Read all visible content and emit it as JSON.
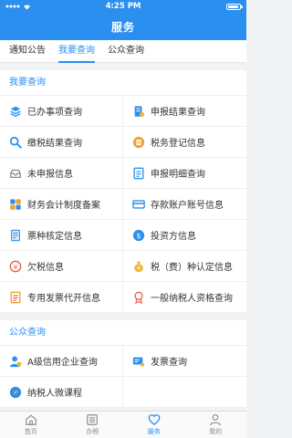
{
  "status": {
    "time": "4:25 PM"
  },
  "header": {
    "title": "服务"
  },
  "tabs": [
    {
      "label": "通知公告"
    },
    {
      "label": "我要查询"
    },
    {
      "label": "公众查询"
    }
  ],
  "section1": {
    "title": "我要查询",
    "items": [
      {
        "label": "已办事项查询",
        "icon": "layers-icon"
      },
      {
        "label": "申报结果查询",
        "icon": "document-icon"
      },
      {
        "label": "缴税结果查询",
        "icon": "search-icon"
      },
      {
        "label": "税务登记信息",
        "icon": "clipboard-icon"
      },
      {
        "label": "未申报信息",
        "icon": "inbox-icon"
      },
      {
        "label": "申报明细查询",
        "icon": "form-icon"
      },
      {
        "label": "财务会计制度备案",
        "icon": "grid-icon"
      },
      {
        "label": "存款账户账号信息",
        "icon": "card-icon"
      },
      {
        "label": "票种核定信息",
        "icon": "ticket-icon"
      },
      {
        "label": "投资方信息",
        "icon": "investor-icon"
      },
      {
        "label": "欠税信息",
        "icon": "debt-icon"
      },
      {
        "label": "税（费）种认定信息",
        "icon": "tax-bag-icon"
      },
      {
        "label": "专用发票代开信息",
        "icon": "invoice-icon"
      },
      {
        "label": "一般纳税人资格查询",
        "icon": "badge-icon"
      }
    ]
  },
  "section2": {
    "title": "公众查询",
    "items": [
      {
        "label": "A级信用企业查询",
        "icon": "user-check-icon"
      },
      {
        "label": "发票查询",
        "icon": "invoice-search-icon"
      },
      {
        "label": "纳税人微课程",
        "icon": "compass-icon"
      }
    ]
  },
  "bottom_nav": [
    {
      "label": "首页",
      "icon": "home-icon"
    },
    {
      "label": "办税",
      "icon": "list-icon"
    },
    {
      "label": "服务",
      "icon": "heart-icon"
    },
    {
      "label": "我的",
      "icon": "person-icon"
    }
  ],
  "colors": {
    "primary": "#2b8ff0",
    "orange": "#f0a030",
    "red": "#e85c4a",
    "yellow": "#f2b632"
  }
}
